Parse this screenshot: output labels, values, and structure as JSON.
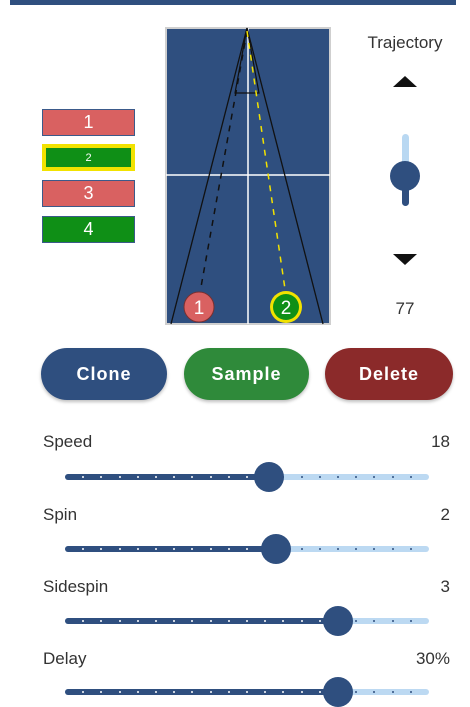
{
  "balls": [
    {
      "label": "1",
      "color": "#d96161",
      "selected": false
    },
    {
      "label": "2",
      "color": "#0f8f16",
      "selected": true
    },
    {
      "label": "3",
      "color": "#d96161",
      "selected": false
    },
    {
      "label": "4",
      "color": "#0f8f16",
      "selected": false
    }
  ],
  "table": {
    "markers": [
      {
        "label": "1",
        "color": "#d96161"
      },
      {
        "label": "2",
        "color": "#0f8f16",
        "ring": "#f2e200"
      }
    ]
  },
  "trajectory": {
    "label": "Trajectory",
    "value": "77",
    "up_icon": "arrow-up-icon",
    "down_icon": "arrow-down-icon",
    "level": 0.5
  },
  "buttons": {
    "clone": "Clone",
    "sample": "Sample",
    "delete": "Delete"
  },
  "sliders": [
    {
      "label": "Speed",
      "value": "18",
      "fraction": 0.56,
      "steps": 20
    },
    {
      "label": "Spin",
      "value": "2",
      "fraction": 0.58,
      "steps": 20
    },
    {
      "label": "Sidespin",
      "value": "3",
      "fraction": 0.75,
      "steps": 20
    },
    {
      "label": "Delay",
      "value": "30%",
      "fraction": 0.75,
      "steps": 20
    }
  ],
  "colors": {
    "accent": "#2f4f7f",
    "track": "#bcd9f2",
    "table": "#2f4f7f",
    "success": "#2f8a3a",
    "danger": "#8b2a2a",
    "highlight": "#f2e200"
  }
}
